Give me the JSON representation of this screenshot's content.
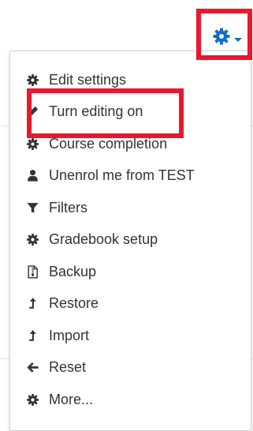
{
  "header": {
    "settings_icon": "gear-icon",
    "dropdown_indicator": "caret-down-icon",
    "accent_color": "#0f6fc5"
  },
  "highlight_color": "#e8192c",
  "menu": {
    "items": [
      {
        "label": "Edit settings",
        "icon": "gear-icon"
      },
      {
        "label": "Turn editing on",
        "icon": "pencil-icon"
      },
      {
        "label": "Course completion",
        "icon": "gear-icon"
      },
      {
        "label": "Unenrol me from TEST",
        "icon": "user-icon"
      },
      {
        "label": "Filters",
        "icon": "filter-icon"
      },
      {
        "label": "Gradebook setup",
        "icon": "gear-icon"
      },
      {
        "label": "Backup",
        "icon": "file-archive-icon"
      },
      {
        "label": "Restore",
        "icon": "level-up-icon"
      },
      {
        "label": "Import",
        "icon": "level-up-icon"
      },
      {
        "label": "Reset",
        "icon": "arrow-left-icon"
      },
      {
        "label": "More...",
        "icon": "gear-icon"
      }
    ]
  }
}
